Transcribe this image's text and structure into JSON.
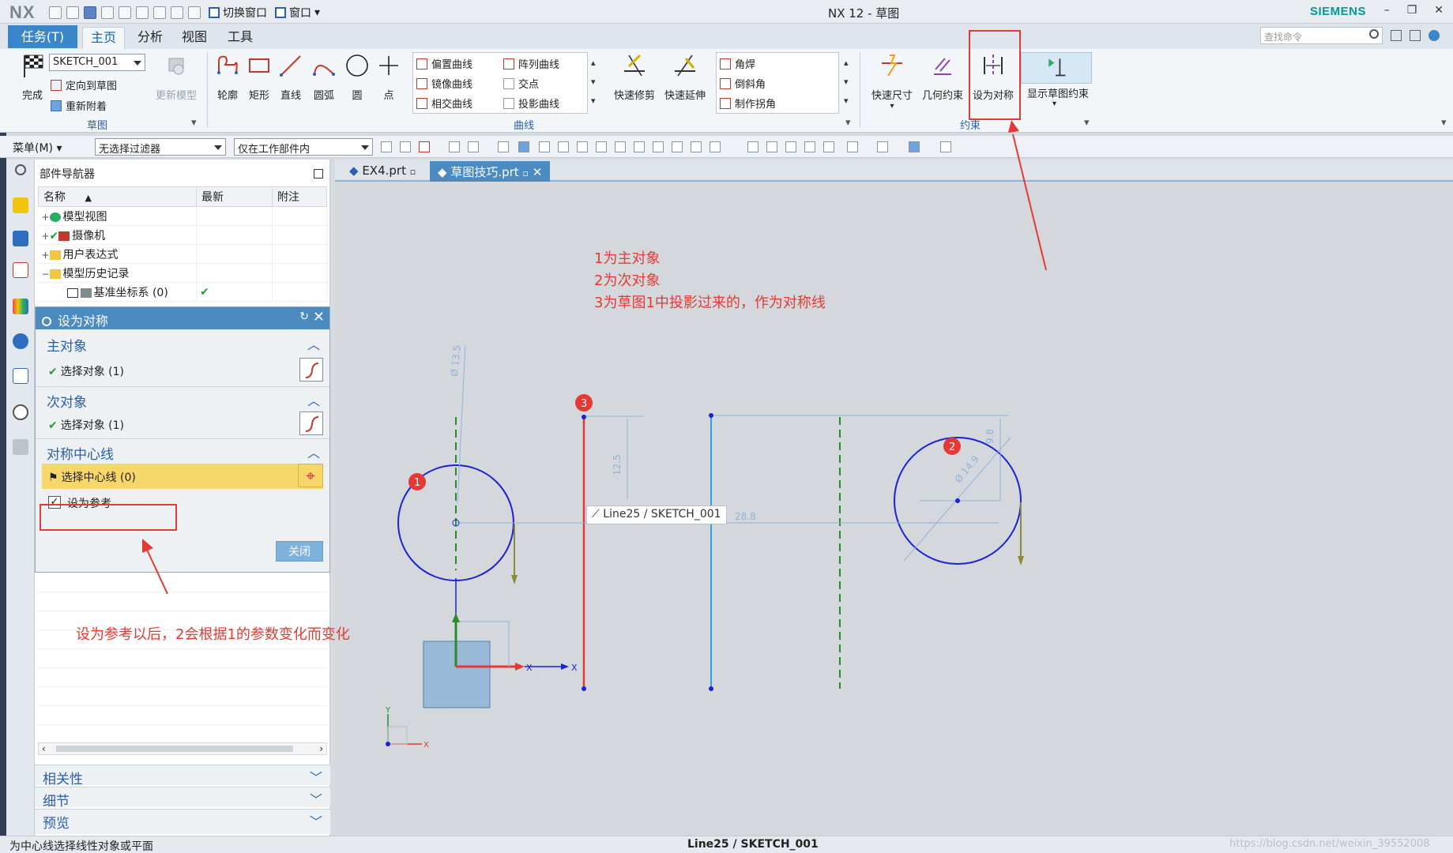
{
  "titlebar": {
    "logo": "NX",
    "switch_window": "切换窗口",
    "window_menu": "窗口",
    "title": "NX 12 - 草图",
    "brand": "SIEMENS"
  },
  "tabs": {
    "task": "任务(T)",
    "items": [
      "主页",
      "分析",
      "视图",
      "工具"
    ],
    "search_placeholder": "查找命令"
  },
  "ribbon": {
    "sketch_group": {
      "finish": "完成",
      "sketch_name": "SKETCH_001",
      "orient": "定向到草图",
      "reattach": "重新附着",
      "update_model": "更新模型",
      "label": "草图"
    },
    "curve_group": {
      "big": [
        "轮廓",
        "矩形",
        "直线",
        "圆弧",
        "圆",
        "点"
      ],
      "small_col1": [
        "偏置曲线",
        "镜像曲线",
        "相交曲线"
      ],
      "small_col2": [
        "阵列曲线",
        "交点",
        "投影曲线"
      ],
      "edit_big": [
        "快速修剪",
        "快速延伸"
      ],
      "corner": [
        "角焊",
        "倒斜角",
        "制作拐角"
      ],
      "label": "曲线"
    },
    "constraint_group": {
      "items": [
        "快速尺寸",
        "几何约束",
        "设为对称",
        "显示草图约束"
      ],
      "label": "约束"
    }
  },
  "cmdbar": {
    "menu": "菜单(M)",
    "filter": "无选择过滤器",
    "scope": "仅在工作部件内"
  },
  "navigator": {
    "title": "部件导航器",
    "columns": [
      "名称",
      "最新",
      "附注"
    ],
    "rows": [
      {
        "expander": "+",
        "label": "模型视图"
      },
      {
        "expander": "+",
        "label": "摄像机"
      },
      {
        "expander": "+",
        "label": "用户表达式"
      },
      {
        "expander": "−",
        "label": "模型历史记录"
      },
      {
        "expander": "",
        "label": "基准坐标系 (0)",
        "latest": "✔"
      }
    ]
  },
  "dialog": {
    "title": "设为对称",
    "primary": {
      "header": "主对象",
      "select": "选择对象 (1)"
    },
    "secondary": {
      "header": "次对象",
      "select": "选择对象 (1)"
    },
    "centerline": {
      "header": "对称中心线",
      "select": "选择中心线 (0)",
      "reference": "设为参考"
    },
    "close": "关闭"
  },
  "lower_panels": [
    "相关性",
    "细节",
    "预览"
  ],
  "file_tabs": [
    "EX4.prt",
    "草图技巧.prt"
  ],
  "canvas": {
    "annotations": [
      "1为主对象",
      "2为次对象",
      "3为草图1中投影过来的，作为对称线"
    ],
    "bottom_note": "设为参考以后，2会根据1的参数变化而变化",
    "tooltip": "Line25 / SKETCH_001",
    "dims": {
      "d1": "Ø 13.5",
      "d2": "Ø 14.9",
      "d3": "9.8",
      "d4": "12.5",
      "d5": "28.8"
    },
    "markers": [
      "1",
      "2",
      "3"
    ],
    "axis": {
      "x": "X",
      "y": "Y"
    }
  },
  "status": {
    "left": "为中心线选择线性对象或平面",
    "center": "Line25 / SKETCH_001",
    "watermark": "https://blog.csdn.net/weixin_39552008"
  },
  "colors": {
    "accent": "#4b8bc0",
    "annotation": "#e53935",
    "curve": "#1a22d6",
    "line_light": "#2aa3e0",
    "centerline": "#2b8a2b"
  }
}
